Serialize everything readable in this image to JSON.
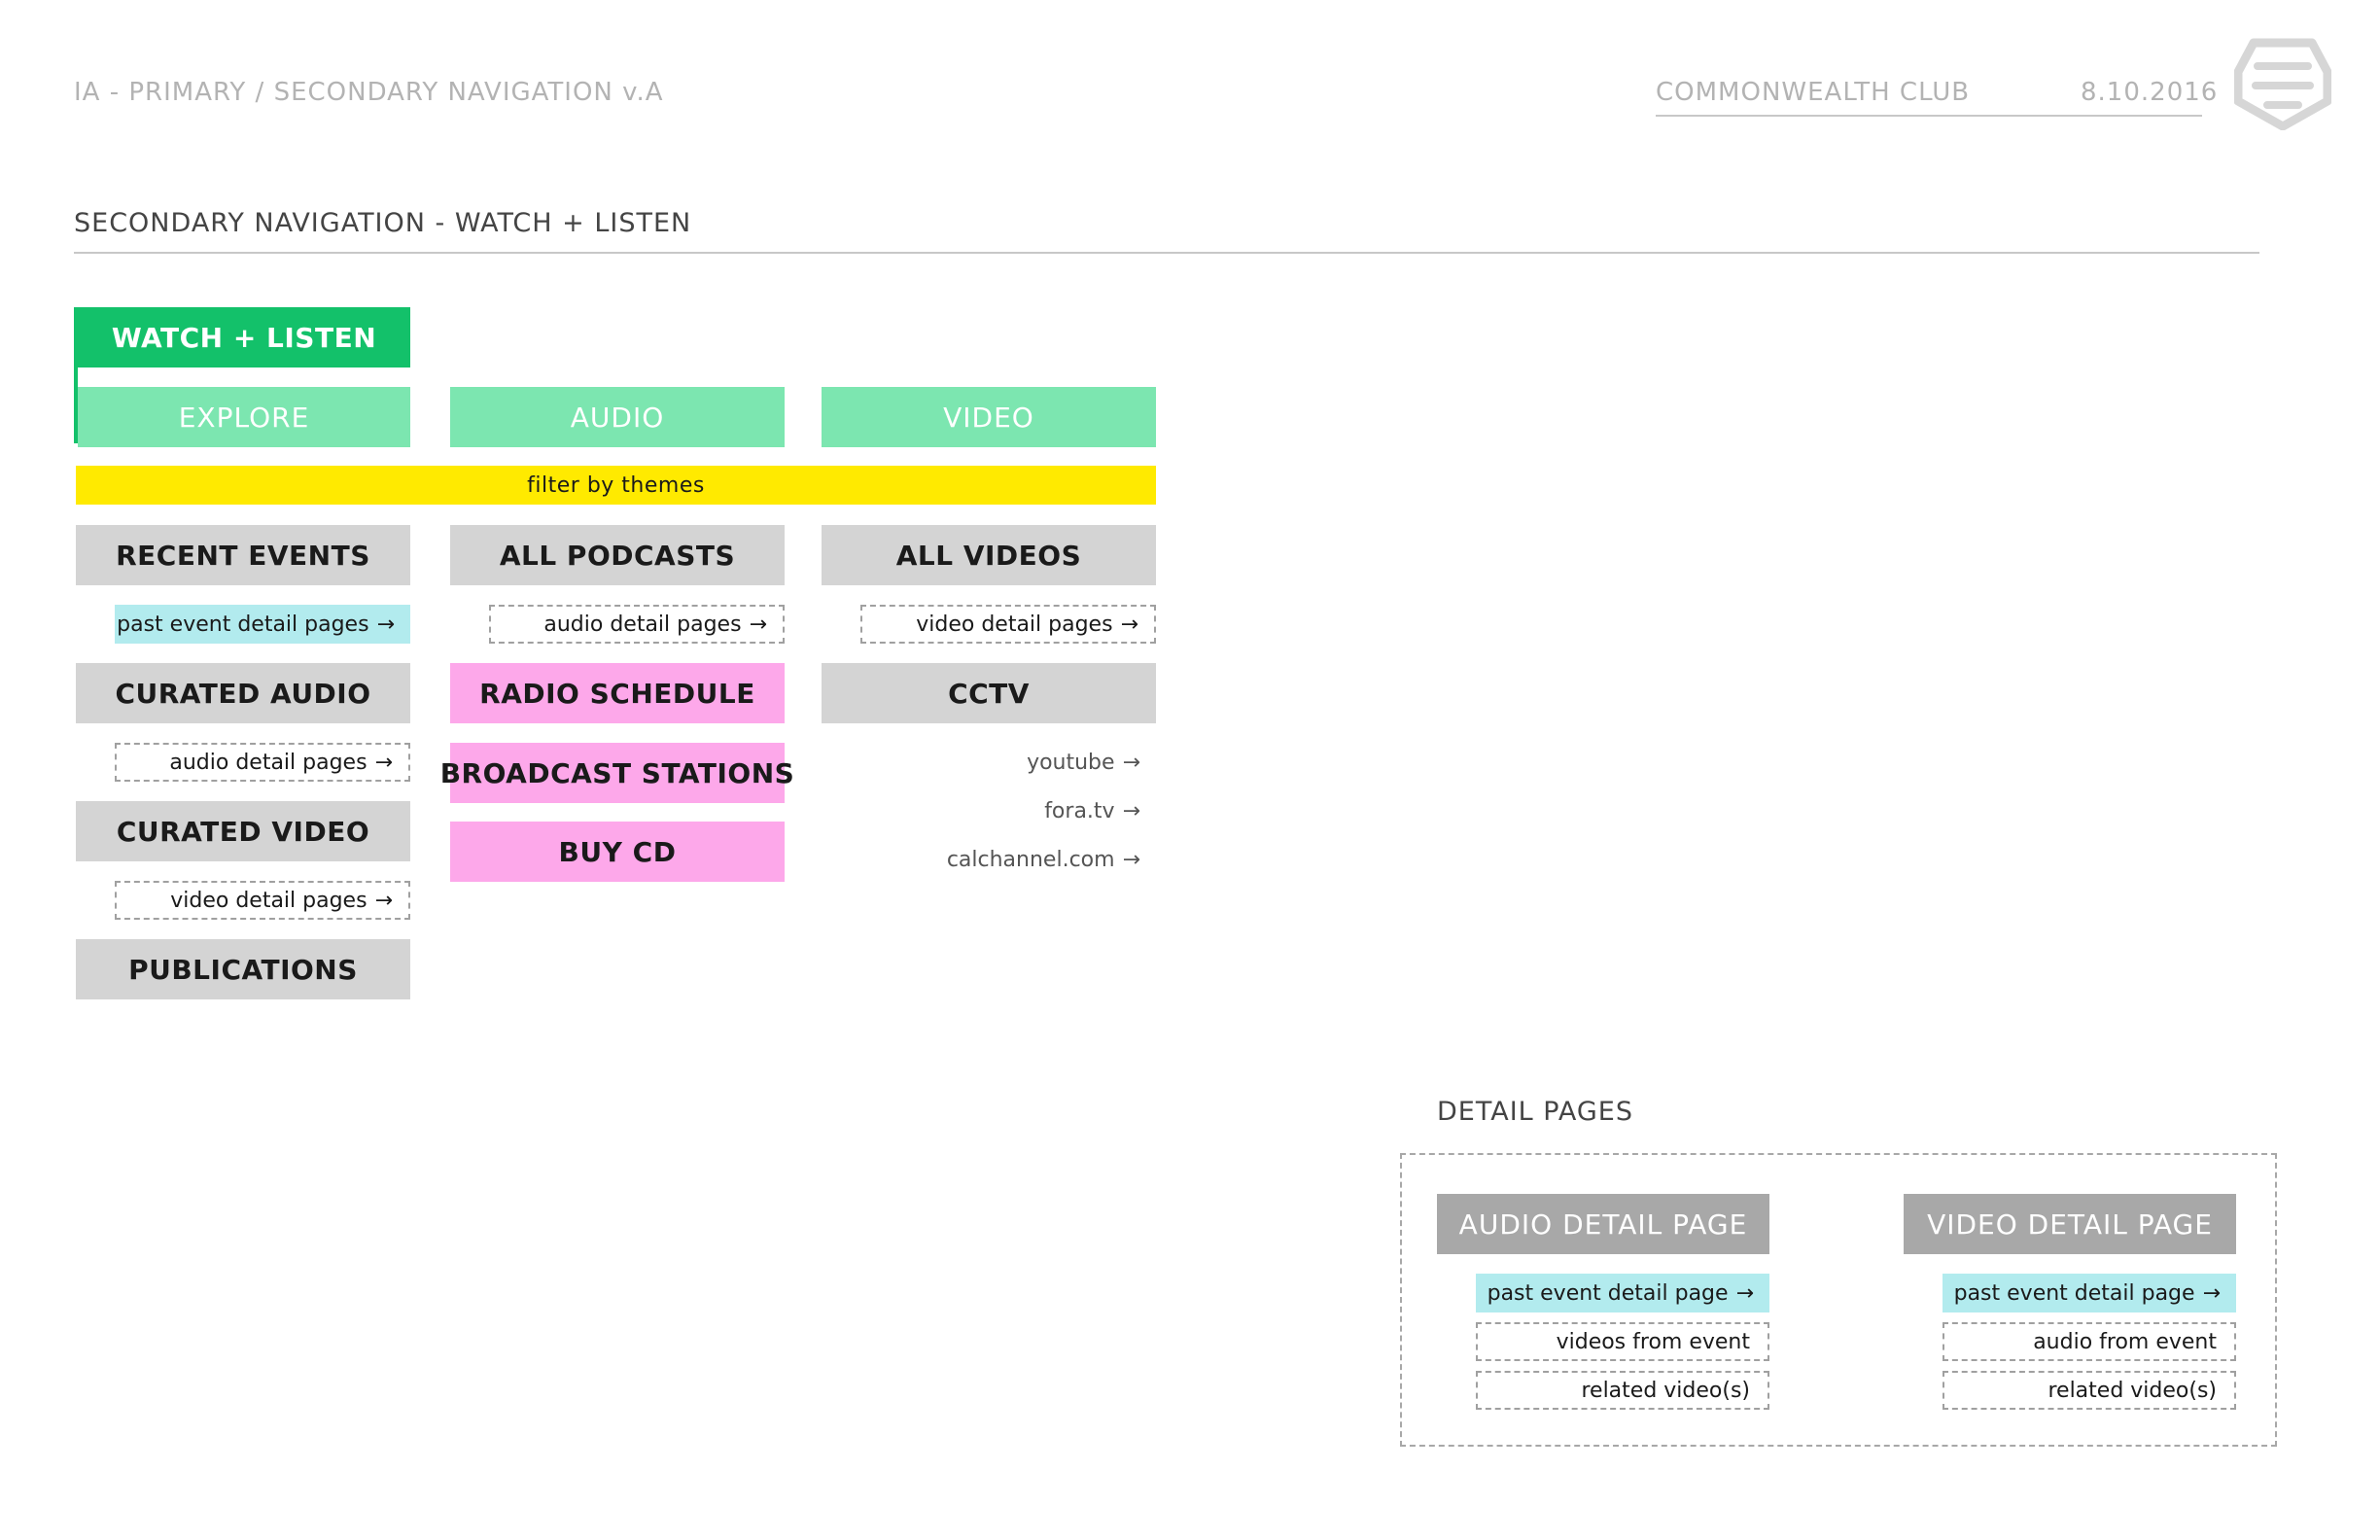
{
  "header": {
    "doc_title": "IA - PRIMARY / SECONDARY NAVIGATION v.A",
    "client": "COMMONWEALTH CLUB",
    "date": "8.10.2016",
    "logo_icon": "club-shield-logo"
  },
  "section": {
    "title": "SECONDARY NAVIGATION - WATCH + LISTEN"
  },
  "nav": {
    "primary": "WATCH + LISTEN",
    "tabs": [
      "EXPLORE",
      "AUDIO",
      "VIDEO"
    ],
    "filter": "filter by themes"
  },
  "explore": {
    "items": [
      {
        "label": "RECENT EVENTS",
        "link": "past event detail pages"
      },
      {
        "label": "CURATED AUDIO",
        "link": "audio detail pages"
      },
      {
        "label": "CURATED VIDEO",
        "link": "video detail pages"
      },
      {
        "label": "PUBLICATIONS"
      }
    ]
  },
  "audio": {
    "main": "ALL PODCASTS",
    "link": "audio detail pages",
    "extras": [
      "RADIO SCHEDULE",
      "BROADCAST STATIONS",
      "BUY CD"
    ]
  },
  "video": {
    "main": "ALL VIDEOS",
    "link": "video detail pages",
    "cctv": "CCTV",
    "external": [
      "youtube",
      "fora.tv",
      "calchannel.com"
    ]
  },
  "detail": {
    "title": "DETAIL PAGES",
    "audio_page": {
      "label": "AUDIO DETAIL PAGE",
      "links": [
        "past event detail page",
        "videos from event",
        "related video(s)"
      ]
    },
    "video_page": {
      "label": "VIDEO DETAIL PAGE",
      "links": [
        "past event detail page",
        "audio from event",
        "related video(s)"
      ]
    }
  },
  "colors": {
    "primary_green": "#13c16a",
    "tab_green": "#7ce6b0",
    "filter_yellow": "#ffea00",
    "nav_grey": "#d4d4d4",
    "radio_pink": "#fda8ea",
    "link_cyan": "#b2ebee",
    "detail_grey": "#a8a8a8"
  }
}
